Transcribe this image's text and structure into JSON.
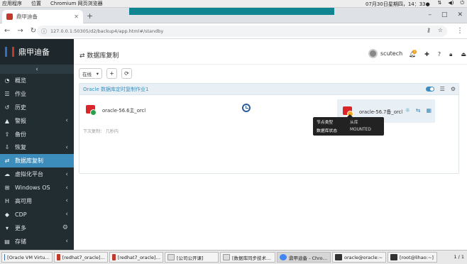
{
  "topbar": {
    "apps": "应用程序",
    "places": "位置",
    "window": "Chromium 网页浏览器",
    "clock": "07月30日星期四，14：33●"
  },
  "browser": {
    "tab_title": "鼎甲迪备",
    "url": "127.0.0.1:50305/d2/backup4/app.html#/standby"
  },
  "sidebar": {
    "brand": "鼎甲迪备",
    "items": [
      {
        "label": "概览",
        "icon": "dashboard-icon",
        "arrow": false
      },
      {
        "label": "作业",
        "icon": "list-icon",
        "arrow": false
      },
      {
        "label": "历史",
        "icon": "history-icon",
        "arrow": false
      },
      {
        "label": "警报",
        "icon": "warning-icon",
        "arrow": true
      },
      {
        "label": "备份",
        "icon": "upload-icon",
        "arrow": false
      },
      {
        "label": "恢复",
        "icon": "download-icon",
        "arrow": true
      },
      {
        "label": "数据库复制",
        "icon": "exchange-icon",
        "arrow": false,
        "active": true
      },
      {
        "label": "虚拟化平台",
        "icon": "cloud-icon",
        "arrow": true
      },
      {
        "label": "Windows OS",
        "icon": "windows-icon",
        "arrow": true
      },
      {
        "label": "高可用",
        "icon": "h-icon",
        "arrow": true
      },
      {
        "label": "CDP",
        "icon": "shield-icon",
        "arrow": true
      },
      {
        "label": "更多",
        "icon": "more-icon",
        "arrow": false
      },
      {
        "label": "存储",
        "icon": "storage-icon",
        "arrow": true
      }
    ]
  },
  "header": {
    "title": "数据库复制",
    "user": "scutech",
    "badge": "1"
  },
  "toolbar": {
    "status_select": "在线"
  },
  "panel": {
    "title": "Oracle 数据库定时复制作业1",
    "source_name": "oracle-56.6主_orcl",
    "target_name": "oracle-56.7备_orcl",
    "footer": "下次复制： 几秒内"
  },
  "tooltip": {
    "rows": [
      {
        "key": "节点类型",
        "value": "从库"
      },
      {
        "key": "数据库状态",
        "value": "MOUNTED"
      }
    ]
  },
  "taskbar": {
    "items": [
      "[Oracle VM Virtu…",
      "[redhat7_oracle]…",
      "[redhat7_oracle]…",
      "[公司公开课]",
      "[数据库同步技术…",
      "鼎甲迪备 - Chro…",
      "oracle@oracle:~",
      "[root@lihao:~]"
    ],
    "pager": "1 / 1"
  }
}
